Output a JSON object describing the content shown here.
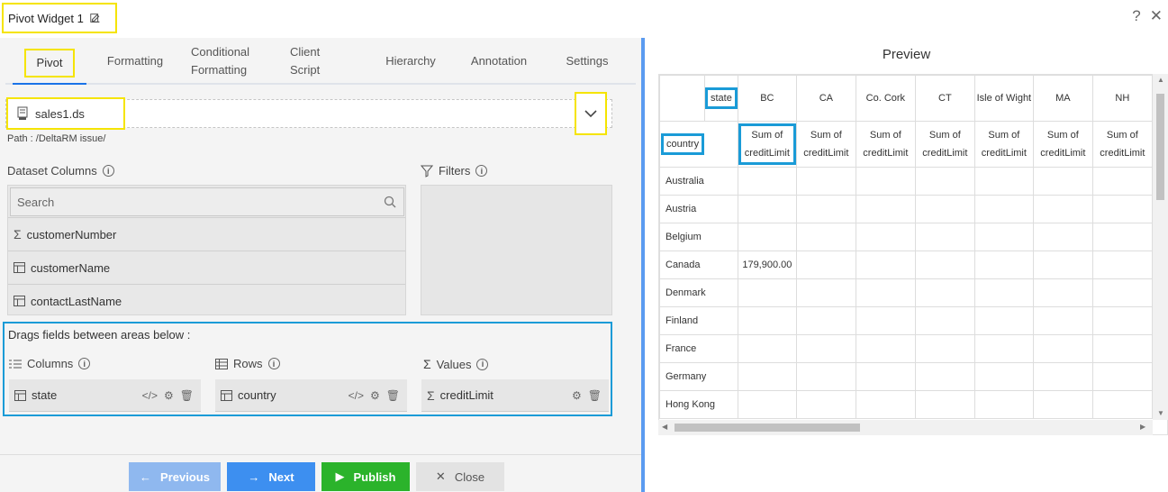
{
  "header": {
    "title": "Pivot Widget 1",
    "help": "?",
    "close": "✕"
  },
  "tabs": [
    {
      "label": "Pivot"
    },
    {
      "label": "Formatting"
    },
    {
      "label": "Conditional Formatting"
    },
    {
      "label": "Client Script"
    },
    {
      "label": "Hierarchy"
    },
    {
      "label": "Annotation"
    },
    {
      "label": "Settings"
    }
  ],
  "dataset": {
    "name": "sales1.ds",
    "path": "Path : /DeltaRM issue/"
  },
  "columns_section": {
    "label": "Dataset Columns",
    "search_placeholder": "Search",
    "items": [
      "customerNumber",
      "customerName",
      "contactLastName"
    ]
  },
  "filters": {
    "label": "Filters"
  },
  "drag": {
    "title": "Drags fields between areas below :",
    "columns_label": "Columns",
    "rows_label": "Rows",
    "values_label": "Values",
    "column_field": "state",
    "row_field": "country",
    "value_field": "creditLimit"
  },
  "footer": {
    "previous": "Previous",
    "next": "Next",
    "publish": "Publish",
    "close": "Close"
  },
  "preview": {
    "title": "Preview",
    "col_field": "state",
    "row_field": "country",
    "states": [
      "BC",
      "CA",
      "Co. Cork",
      "CT",
      "Isle of Wight",
      "MA",
      "NH"
    ],
    "measure": "Sum of creditLimit",
    "rows": [
      {
        "country": "Australia",
        "values": [
          "",
          "",
          "",
          "",
          "",
          "",
          ""
        ]
      },
      {
        "country": "Austria",
        "values": [
          "",
          "",
          "",
          "",
          "",
          "",
          ""
        ]
      },
      {
        "country": "Belgium",
        "values": [
          "",
          "",
          "",
          "",
          "",
          "",
          ""
        ]
      },
      {
        "country": "Canada",
        "values": [
          "179,900.00",
          "",
          "",
          "",
          "",
          "",
          ""
        ]
      },
      {
        "country": "Denmark",
        "values": [
          "",
          "",
          "",
          "",
          "",
          "",
          ""
        ]
      },
      {
        "country": "Finland",
        "values": [
          "",
          "",
          "",
          "",
          "",
          "",
          ""
        ]
      },
      {
        "country": "France",
        "values": [
          "",
          "",
          "",
          "",
          "",
          "",
          ""
        ]
      },
      {
        "country": "Germany",
        "values": [
          "",
          "",
          "",
          "",
          "",
          "",
          ""
        ]
      },
      {
        "country": "Hong Kong",
        "values": [
          "",
          "",
          "",
          "",
          "",
          "",
          ""
        ]
      }
    ]
  },
  "colors": {
    "accent": "#1a73e8",
    "highlight_yellow": "#f5e400",
    "highlight_blue": "#1a9bd7",
    "publish": "#2bb32b"
  }
}
